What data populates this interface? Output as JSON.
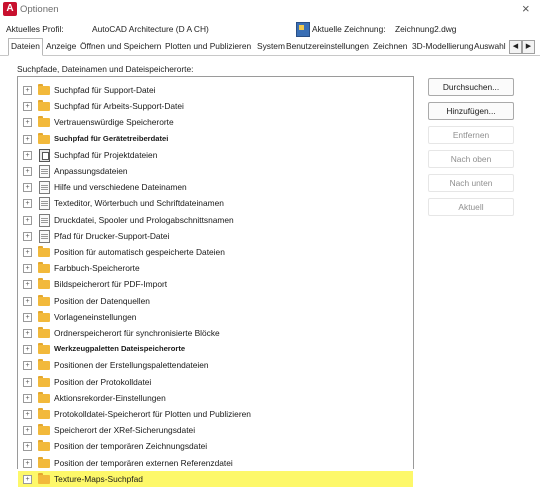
{
  "window": {
    "title": "Optionen",
    "app_icon_letter": "A"
  },
  "profile": {
    "current_profile_label": "Aktuelles Profil:",
    "current_profile_value": "AutoCAD Architecture (D A CH)",
    "current_drawing_label": "Aktuelle Zeichnung:",
    "current_drawing_value": "Zeichnung2.dwg"
  },
  "tabs": [
    {
      "label": "Dateien",
      "active": true
    },
    {
      "label": "Anzeige"
    },
    {
      "label": "Öffnen und Speichern"
    },
    {
      "label": "Plotten und Publizieren"
    },
    {
      "label": "System"
    },
    {
      "label": "Benutzereinstellungen"
    },
    {
      "label": "Zeichnen"
    },
    {
      "label": "3D-Modellierung"
    },
    {
      "label": "Auswahl"
    }
  ],
  "tab_scroll": {
    "left": "◀",
    "right": "▶"
  },
  "section_title": "Suchpfade, Dateinamen und Dateispeicherorte:",
  "tree": {
    "expander_symbol": "+",
    "items": [
      {
        "label": "Suchpfad für Support-Datei",
        "icon": "folder-icon"
      },
      {
        "label": "Suchpfad für Arbeits-Support-Datei",
        "icon": "folder-icon"
      },
      {
        "label": "Vertrauenswürdige Speicherorte",
        "icon": "folder-icon"
      },
      {
        "label": "Suchpfad für Gerätetreiberdatei",
        "icon": "folder-icon",
        "bold": true
      },
      {
        "label": "Suchpfad für Projektdateien",
        "icon": "stack-icon"
      },
      {
        "label": "Anpassungsdateien",
        "icon": "doc-icon"
      },
      {
        "label": "Hilfe und verschiedene Dateinamen",
        "icon": "doc-icon"
      },
      {
        "label": "Texteditor, Wörterbuch und Schriftdateinamen",
        "icon": "doc-icon"
      },
      {
        "label": "Druckdatei, Spooler und Prologabschnittsnamen",
        "icon": "doc-icon"
      },
      {
        "label": "Pfad für Drucker-Support-Datei",
        "icon": "doc-icon"
      },
      {
        "label": "Position für automatisch gespeicherte Dateien",
        "icon": "folder-icon"
      },
      {
        "label": "Farbbuch-Speicherorte",
        "icon": "folder-icon"
      },
      {
        "label": "Bildspeicherort für PDF-Import",
        "icon": "folder-icon"
      },
      {
        "label": "Position der Datenquellen",
        "icon": "folder-icon"
      },
      {
        "label": "Vorlageneinstellungen",
        "icon": "folder-icon"
      },
      {
        "label": "Ordnerspeicherort für synchronisierte Blöcke",
        "icon": "folder-icon"
      },
      {
        "label": "Werkzeugpaletten Dateispeicherorte",
        "icon": "folder-icon",
        "bold": true
      },
      {
        "label": "Positionen der Erstellungspalettendateien",
        "icon": "folder-icon"
      },
      {
        "label": "Position der Protokolldatei",
        "icon": "folder-icon"
      },
      {
        "label": "Aktionsrekorder-Einstellungen",
        "icon": "folder-icon"
      },
      {
        "label": "Protokolldatei-Speicherort für Plotten und Publizieren",
        "icon": "folder-icon"
      },
      {
        "label": "Speicherort der XRef-Sicherungsdatei",
        "icon": "folder-icon"
      },
      {
        "label": "Position der temporären Zeichnungsdatei",
        "icon": "folder-icon"
      },
      {
        "label": "Position der temporären externen Referenzdatei",
        "icon": "folder-icon"
      },
      {
        "label": "Texture-Maps-Suchpfad",
        "icon": "folder-icon",
        "highlighted": true
      }
    ]
  },
  "buttons": {
    "browse": "Durchsuchen...",
    "add": "Hinzufügen...",
    "remove": "Entfernen",
    "move_up": "Nach oben",
    "move_down": "Nach unten",
    "current": "Aktuell"
  },
  "close_glyph": "×",
  "colors": {
    "highlight": "#fdf86a",
    "folder": "#f2b93b",
    "app_red": "#c8102e"
  }
}
